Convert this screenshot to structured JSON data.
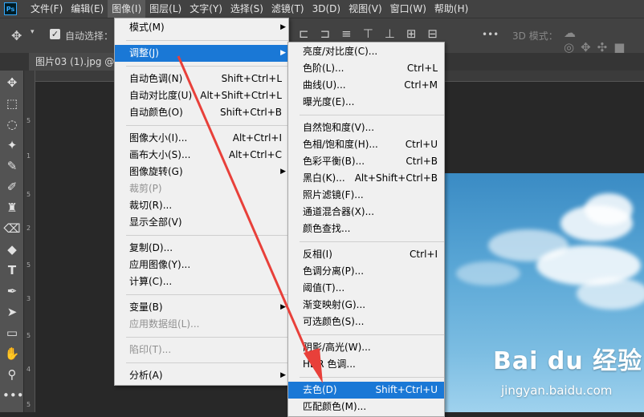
{
  "menubar": {
    "logo": "Ps",
    "items": [
      {
        "label": "文件(F)",
        "active": false
      },
      {
        "label": "编辑(E)",
        "active": false
      },
      {
        "label": "图像(I)",
        "active": true
      },
      {
        "label": "图层(L)",
        "active": false
      },
      {
        "label": "文字(Y)",
        "active": false
      },
      {
        "label": "选择(S)",
        "active": false
      },
      {
        "label": "滤镜(T)",
        "active": false
      },
      {
        "label": "3D(D)",
        "active": false
      },
      {
        "label": "视图(V)",
        "active": false
      },
      {
        "label": "窗口(W)",
        "active": false
      },
      {
        "label": "帮助(H)",
        "active": false
      }
    ]
  },
  "options": {
    "auto_select_label": "自动选择：",
    "mode_3d_label": "3D 模式：",
    "more": "•••"
  },
  "document": {
    "tab_title": "图片03 (1).jpg @"
  },
  "rulers": {
    "vertical": [
      "5",
      "1",
      "5",
      "2",
      "5",
      "3",
      "5",
      "4",
      "5"
    ]
  },
  "image_menu": {
    "items": [
      {
        "label": "模式(M)",
        "shortcut": "",
        "submenu": true,
        "disabled": false,
        "highlight": false
      },
      {
        "sep": true
      },
      {
        "label": "调整(J)",
        "shortcut": "",
        "submenu": true,
        "disabled": false,
        "highlight": true
      },
      {
        "sep": true
      },
      {
        "label": "自动色调(N)",
        "shortcut": "Shift+Ctrl+L",
        "submenu": false,
        "disabled": false,
        "highlight": false
      },
      {
        "label": "自动对比度(U)",
        "shortcut": "Alt+Shift+Ctrl+L",
        "submenu": false,
        "disabled": false,
        "highlight": false
      },
      {
        "label": "自动颜色(O)",
        "shortcut": "Shift+Ctrl+B",
        "submenu": false,
        "disabled": false,
        "highlight": false
      },
      {
        "sep": true
      },
      {
        "label": "图像大小(I)...",
        "shortcut": "Alt+Ctrl+I",
        "submenu": false,
        "disabled": false,
        "highlight": false
      },
      {
        "label": "画布大小(S)...",
        "shortcut": "Alt+Ctrl+C",
        "submenu": false,
        "disabled": false,
        "highlight": false
      },
      {
        "label": "图像旋转(G)",
        "shortcut": "",
        "submenu": true,
        "disabled": false,
        "highlight": false
      },
      {
        "label": "裁剪(P)",
        "shortcut": "",
        "submenu": false,
        "disabled": true,
        "highlight": false
      },
      {
        "label": "裁切(R)...",
        "shortcut": "",
        "submenu": false,
        "disabled": false,
        "highlight": false
      },
      {
        "label": "显示全部(V)",
        "shortcut": "",
        "submenu": false,
        "disabled": false,
        "highlight": false
      },
      {
        "sep": true
      },
      {
        "label": "复制(D)...",
        "shortcut": "",
        "submenu": false,
        "disabled": false,
        "highlight": false
      },
      {
        "label": "应用图像(Y)...",
        "shortcut": "",
        "submenu": false,
        "disabled": false,
        "highlight": false
      },
      {
        "label": "计算(C)...",
        "shortcut": "",
        "submenu": false,
        "disabled": false,
        "highlight": false
      },
      {
        "sep": true
      },
      {
        "label": "变量(B)",
        "shortcut": "",
        "submenu": true,
        "disabled": false,
        "highlight": false
      },
      {
        "label": "应用数据组(L)...",
        "shortcut": "",
        "submenu": false,
        "disabled": true,
        "highlight": false
      },
      {
        "sep": true
      },
      {
        "label": "陷印(T)...",
        "shortcut": "",
        "submenu": false,
        "disabled": true,
        "highlight": false
      },
      {
        "sep": true
      },
      {
        "label": "分析(A)",
        "shortcut": "",
        "submenu": true,
        "disabled": false,
        "highlight": false
      }
    ]
  },
  "adjust_menu": {
    "items": [
      {
        "label": "亮度/对比度(C)...",
        "shortcut": "",
        "highlight": false
      },
      {
        "label": "色阶(L)...",
        "shortcut": "Ctrl+L",
        "highlight": false
      },
      {
        "label": "曲线(U)...",
        "shortcut": "Ctrl+M",
        "highlight": false
      },
      {
        "label": "曝光度(E)...",
        "shortcut": "",
        "highlight": false
      },
      {
        "sep": true
      },
      {
        "label": "自然饱和度(V)...",
        "shortcut": "",
        "highlight": false
      },
      {
        "label": "色相/饱和度(H)...",
        "shortcut": "Ctrl+U",
        "highlight": false
      },
      {
        "label": "色彩平衡(B)...",
        "shortcut": "Ctrl+B",
        "highlight": false
      },
      {
        "label": "黑白(K)...",
        "shortcut": "Alt+Shift+Ctrl+B",
        "highlight": false
      },
      {
        "label": "照片滤镜(F)...",
        "shortcut": "",
        "highlight": false
      },
      {
        "label": "通道混合器(X)...",
        "shortcut": "",
        "highlight": false
      },
      {
        "label": "颜色查找...",
        "shortcut": "",
        "highlight": false
      },
      {
        "sep": true
      },
      {
        "label": "反相(I)",
        "shortcut": "Ctrl+I",
        "highlight": false
      },
      {
        "label": "色调分离(P)...",
        "shortcut": "",
        "highlight": false
      },
      {
        "label": "阈值(T)...",
        "shortcut": "",
        "highlight": false
      },
      {
        "label": "渐变映射(G)...",
        "shortcut": "",
        "highlight": false
      },
      {
        "label": "可选颜色(S)...",
        "shortcut": "",
        "highlight": false
      },
      {
        "sep": true
      },
      {
        "label": "阴影/高光(W)...",
        "shortcut": "",
        "highlight": false
      },
      {
        "label": "HDR 色调...",
        "shortcut": "",
        "highlight": false
      },
      {
        "sep": true
      },
      {
        "label": "去色(D)",
        "shortcut": "Shift+Ctrl+U",
        "highlight": true
      },
      {
        "label": "匹配颜色(M)...",
        "shortcut": "",
        "highlight": false
      }
    ]
  },
  "watermark": {
    "logo": "Bai du 经验",
    "url": "jingyan.baidu.com"
  },
  "colors": {
    "highlight": "#1a78d6",
    "annotation": "#e8403a"
  }
}
